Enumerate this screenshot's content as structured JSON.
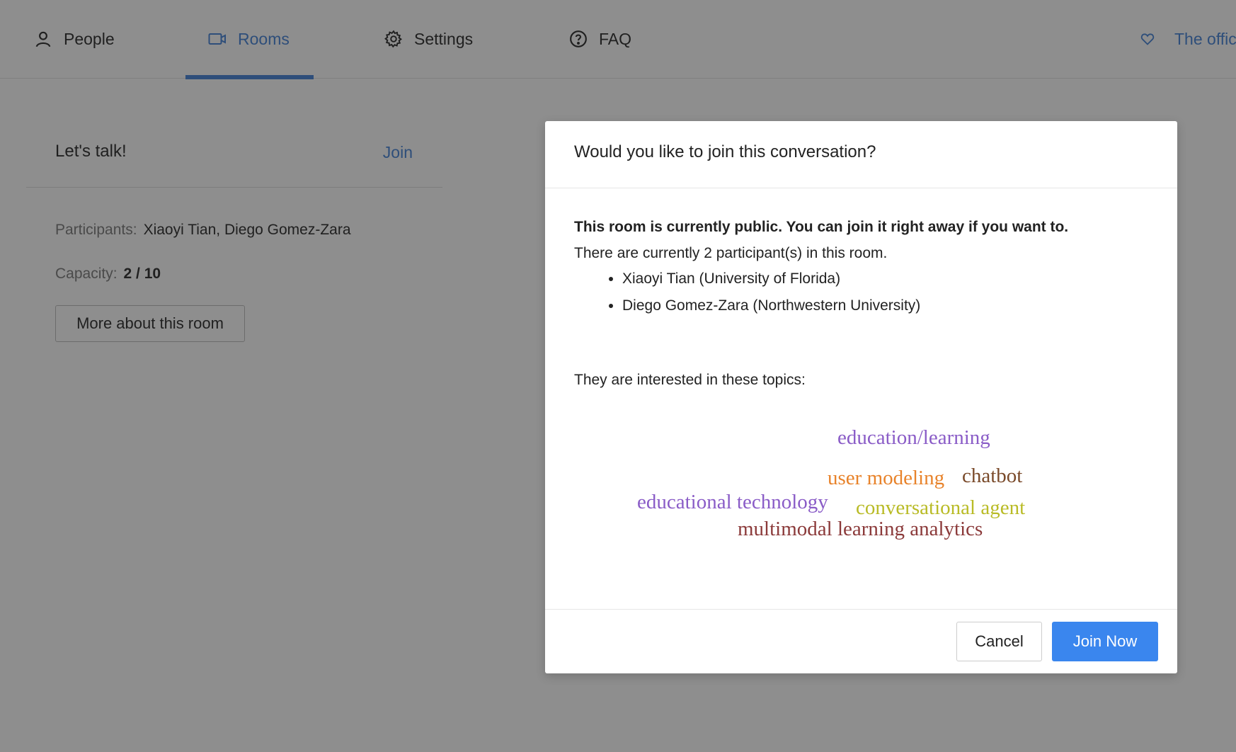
{
  "nav": {
    "items": [
      {
        "label": "People",
        "icon": "person-icon"
      },
      {
        "label": "Rooms",
        "icon": "video-icon",
        "active": true
      },
      {
        "label": "Settings",
        "icon": "gear-icon"
      },
      {
        "label": "FAQ",
        "icon": "question-circle-icon"
      }
    ],
    "official_link": {
      "label": "The offici",
      "icon": "heart-icon"
    }
  },
  "room_card": {
    "title": "Let's talk!",
    "join_label": "Join",
    "participants_label": "Participants:",
    "participants_value": "Xiaoyi Tian, Diego Gomez-Zara",
    "capacity_label": "Capacity:",
    "capacity_value": "2 / 10",
    "more_button": "More about this room"
  },
  "modal": {
    "title": "Would you like to join this conversation?",
    "public_note": "This room is currently public. You can join it right away if you want to.",
    "participants_count": "There are currently 2 participant(s) in this room.",
    "participants": [
      "Xiaoyi Tian (University of Florida)",
      "Diego Gomez-Zara (Northwestern University)"
    ],
    "topics_intro": "They are interested in these topics:",
    "topics": [
      {
        "text": "education/learning",
        "color": "#8a5cc7"
      },
      {
        "text": "user modeling",
        "color": "#e8832b"
      },
      {
        "text": "chatbot",
        "color": "#7a4a2a"
      },
      {
        "text": "educational technology",
        "color": "#8a5cc7"
      },
      {
        "text": "conversational agent",
        "color": "#b9bb26"
      },
      {
        "text": "multimodal learning analytics",
        "color": "#8b3a3a"
      }
    ],
    "cancel_label": "Cancel",
    "join_now_label": "Join Now"
  },
  "colors": {
    "accent": "#3f7fd6",
    "primary_button": "#3a86ee"
  }
}
